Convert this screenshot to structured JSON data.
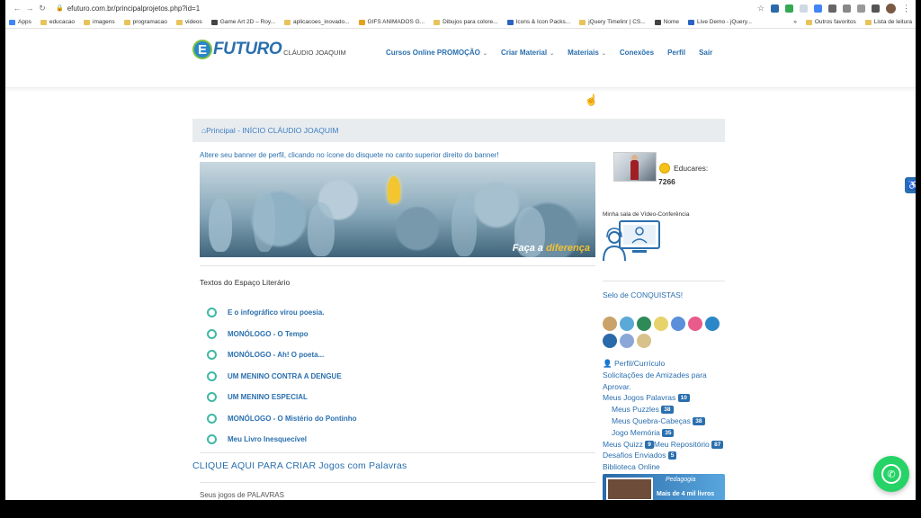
{
  "browser": {
    "url": "efuturo.com.br/principalprojetos.php?id=1",
    "bookmarks": [
      "Apps",
      "educacao",
      "imagens",
      "programacao",
      "videos",
      "Game Art 2D – Roy...",
      "aplicacoes_inovado...",
      "GIFS ANIMADOS G...",
      "Dibujos para colore...",
      "Icons & Icon Packs...",
      "jQuery Timelinr | CS...",
      "Nome",
      "Live Demo - jQuery..."
    ],
    "bookmarks_right": [
      "Outros favoritos",
      "Lista de leitura"
    ]
  },
  "header": {
    "logo_letter": "E",
    "logo_word": "FUTURO",
    "user_name": "CLÁUDIO JOAQUIM",
    "nav": [
      {
        "label": "Cursos Online PROMOÇÃO",
        "dropdown": true
      },
      {
        "label": "Criar Material",
        "dropdown": true
      },
      {
        "label": "Materiais",
        "dropdown": true
      },
      {
        "label": "Conexões",
        "dropdown": false
      },
      {
        "label": "Perfil",
        "dropdown": false
      },
      {
        "label": "Sair",
        "dropdown": false
      }
    ]
  },
  "breadcrumb": "Principal - INÍCIO CLÁUDIO JOAQUIM",
  "banner": {
    "note": "Altere seu banner de perfil, clicando no ícone do disquete no canto superior direito do banner!",
    "text_a": "Faça a ",
    "text_b": "diferença"
  },
  "literary": {
    "title": "Textos do Espaço Literário",
    "items": [
      "E o infográfico virou poesia.",
      "MONÓLOGO - O Tempo",
      "MONÓLOGO - Ah! O poeta...",
      "UM MENINO CONTRA A DENGUE",
      "UM MENINO ESPECIAL",
      "MONÓLOGO - O Mistério do Pontinho",
      "Meu Livro Inesquecível"
    ]
  },
  "cta": "CLIQUE AQUI PARA CRIAR Jogos com Palavras",
  "more_label": "Seus jogos de PALAVRAS",
  "sidebar": {
    "educares_label": "Educares:",
    "educares_count": "7266",
    "video_label": "Minha sala de Vídeo-Conferência",
    "selo": "Selo de CONQUISTAS!",
    "badge_colors": [
      "#c9a36a",
      "#5aa9d6",
      "#2e8b57",
      "#e7d36b",
      "#5b8fd9",
      "#e95b8a",
      "#2b87c8",
      "#2b6aa8",
      "#8aa7d8",
      "#d8c28a"
    ],
    "links": {
      "perfil": "Perfil/Currículo",
      "amizades": "Solicitações de Amizades para Aprovar.",
      "palavras": "Meus Jogos Palavras",
      "palavras_count": "10",
      "puzzles": "Meus Puzzles",
      "puzzles_count": "38",
      "quebra": "Meus Quebra-Cabeças",
      "quebra_count": "38",
      "memoria": "Jogo Memória",
      "memoria_count": "35",
      "quizz": "Meus Quizz",
      "quizz_count": "9",
      "repositorio": "Meu Repositório",
      "repositorio_count": "87",
      "desafios": "Desafios Enviados",
      "desafios_count": "5",
      "biblioteca": "Biblioteca Online"
    },
    "promo_top": "Pedagogia",
    "promo_bottom": "Mais de 4 mil livros"
  }
}
